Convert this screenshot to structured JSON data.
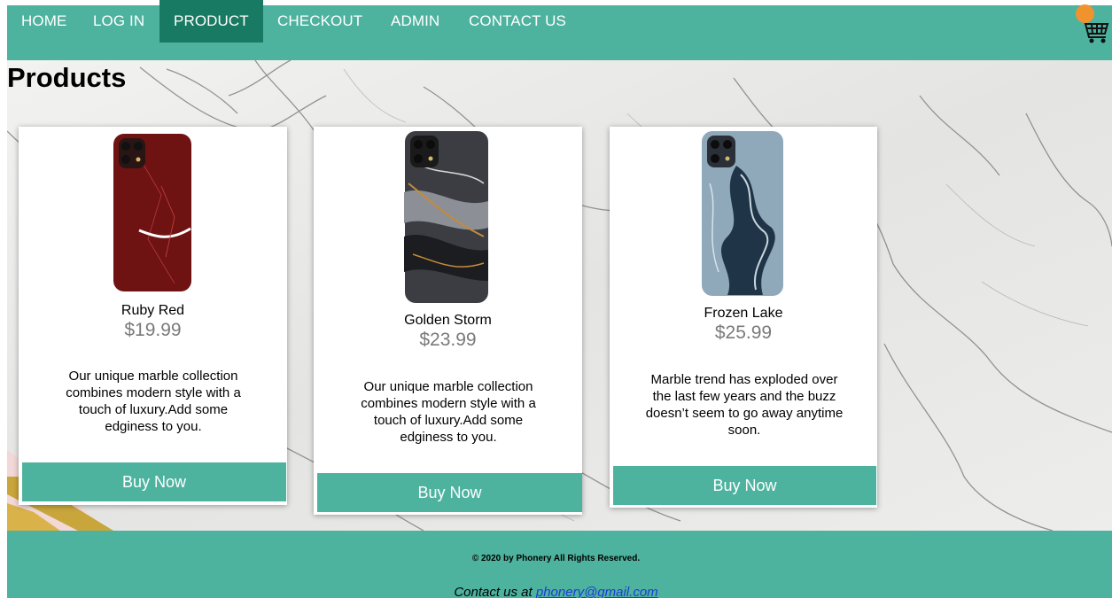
{
  "nav": {
    "items": [
      {
        "label": "HOME"
      },
      {
        "label": "LOG IN"
      },
      {
        "label": "PRODUCT"
      },
      {
        "label": "CHECKOUT"
      },
      {
        "label": "ADMIN"
      },
      {
        "label": "CONTACT US"
      }
    ],
    "active_label": "PRODUCT",
    "cart_icon": "shopping-cart-icon",
    "badge_color": "#f0922e"
  },
  "page": {
    "title": "Products"
  },
  "products": [
    {
      "name": "Ruby Red",
      "price": "$19.99",
      "description": "Our unique marble collection combines modern style with a touch of luxury.Add some edginess to you.",
      "button": "Buy Now",
      "case_color": "#6e1212"
    },
    {
      "name": "Golden Storm",
      "price": "$23.99",
      "description": "Our unique marble collection combines modern style with a touch of luxury.Add some edginess to you.",
      "button": "Buy Now",
      "case_color": "#3b3d42"
    },
    {
      "name": "Frozen Lake",
      "price": "$25.99",
      "description": "Marble trend has exploded over the last few years and the buzz doesn’t seem to go away anytime soon.",
      "button": "Buy Now",
      "case_color": "#5f7f95"
    }
  ],
  "footer": {
    "copyright": "© 2020 by Phonery All Rights Reserved.",
    "contact_prefix": "Contact us at ",
    "contact_email": "phonery@gmail.com"
  },
  "colors": {
    "brand": "#4db39f",
    "active_nav": "#187a63",
    "link": "#1f3bd6"
  }
}
